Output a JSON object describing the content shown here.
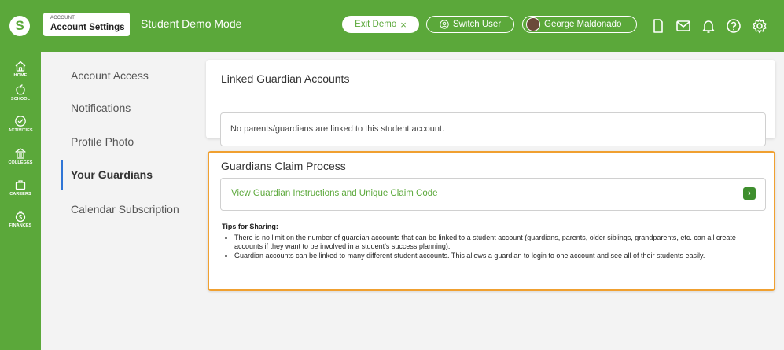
{
  "header": {
    "account_small": "ACCOUNT",
    "account_title": "Account Settings",
    "mode_title": "Student Demo Mode",
    "exit_demo": "Exit Demo",
    "exit_glyph": "×",
    "switch_user": "Switch User",
    "user_name": "George Maldonado",
    "logo_letter": "S",
    "accent_color": "#5ba83a",
    "icons": [
      "document-icon",
      "mail-icon",
      "bell-icon",
      "help-icon",
      "settings-icon"
    ]
  },
  "sidebar": {
    "items": [
      {
        "label": "HOME",
        "icon": "home-icon"
      },
      {
        "label": "SCHOOL",
        "icon": "apple-icon"
      },
      {
        "label": "ACTIVITIES",
        "icon": "checkmark-icon"
      },
      {
        "label": "COLLEGES",
        "icon": "college-icon"
      },
      {
        "label": "CAREERS",
        "icon": "briefcase-icon"
      },
      {
        "label": "FINANCES",
        "icon": "money-icon"
      }
    ]
  },
  "settings_menu": {
    "items": [
      "Account Access",
      "Notifications",
      "Profile Photo",
      "Your Guardians",
      "Calendar Subscription"
    ],
    "active": "Your Guardians"
  },
  "linked": {
    "title": "Linked Guardian Accounts",
    "message": "No parents/guardians are linked to this student account."
  },
  "claim": {
    "title": "Guardians Claim Process",
    "link_text": "View Guardian Instructions and Unique Claim Code",
    "arrow_glyph": "›",
    "tips_heading": "Tips for Sharing:",
    "tips": [
      "There is no limit on the number of guardian accounts that can be linked to a student account (guardians, parents, older siblings, grandparents, etc. can all create accounts if they want to be involved in a student's success planning).",
      "Guardian accounts can be linked to many different student accounts. This allows a guardian to login to one account and see all of their students easily."
    ],
    "highlight_color": "#f0a030"
  }
}
